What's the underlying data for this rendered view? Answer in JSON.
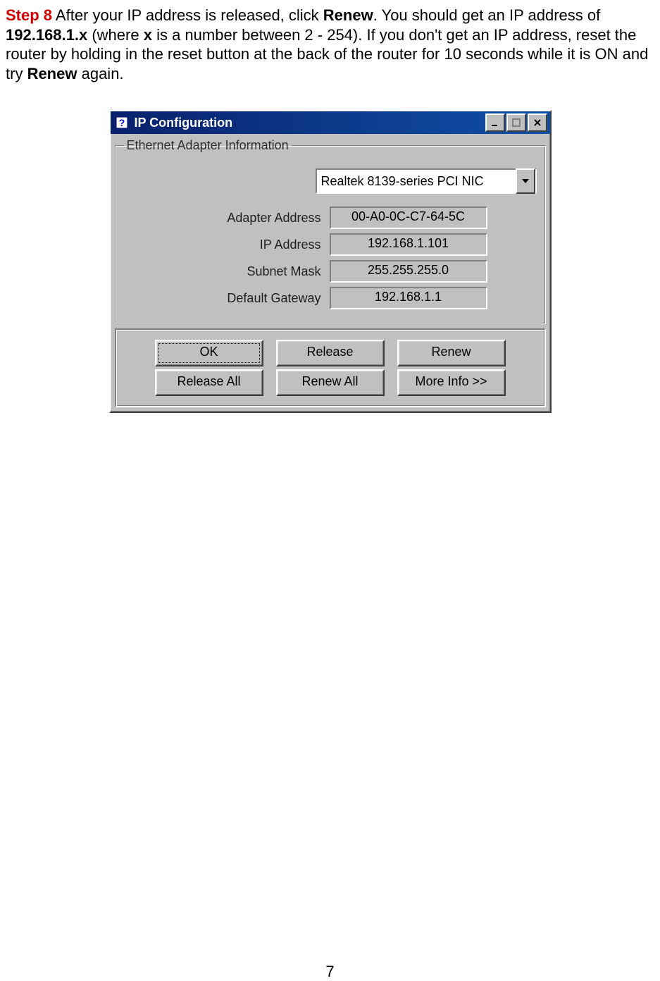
{
  "instruction": {
    "step_label": "Step 8",
    "text_part1": " After your IP address is released, click ",
    "bold_renew": "Renew",
    "text_part2": ". You should get an IP address of ",
    "bold_ip": "192.168.1.x",
    "text_part3": " (where ",
    "bold_x": "x",
    "text_part4": " is a number between 2 - 254). If you don't get an IP address, reset the router by holding in the reset button at the back of the router for 10 seconds while it is ON and try ",
    "bold_renew2": "Renew",
    "text_part5": " again."
  },
  "dialog": {
    "title": "IP Configuration",
    "groupbox_title": "Ethernet Adapter Information",
    "adapter_selected": "Realtek 8139-series PCI NIC",
    "fields": {
      "adapter_address_label": "Adapter Address",
      "adapter_address_value": "00-A0-0C-C7-64-5C",
      "ip_address_label": "IP Address",
      "ip_address_value": "192.168.1.101",
      "subnet_mask_label": "Subnet Mask",
      "subnet_mask_value": "255.255.255.0",
      "default_gateway_label": "Default Gateway",
      "default_gateway_value": "192.168.1.1"
    },
    "buttons": {
      "ok": "OK",
      "release": "Release",
      "renew": "Renew",
      "release_all": "Release All",
      "renew_all": "Renew All",
      "more_info": "More Info >>"
    }
  },
  "page_number": "7"
}
